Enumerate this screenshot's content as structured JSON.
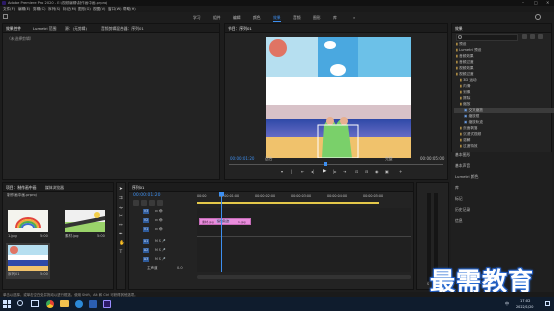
{
  "title_bar": {
    "app_title": "Adobe Premiere Pro 2020 - E:\\视频编辑\\制作画中画.prproj",
    "menu": [
      "文件(F)",
      "编辑(E)",
      "剪辑(C)",
      "序列(S)",
      "标记(M)",
      "图形(G)",
      "视图(V)",
      "窗口(W)",
      "帮助(H)"
    ]
  },
  "workspaces": [
    "学习",
    "组件",
    "编辑",
    "颜色",
    "效果",
    "音频",
    "图形",
    "库",
    "»"
  ],
  "effect_controls": {
    "tabs": [
      "效果控件",
      "Lumetri 范围",
      "源：(无剪辑)",
      "音频剪辑混合器：序列01"
    ],
    "placeholder": "（未选择剪辑）"
  },
  "program_monitor": {
    "tab": "节目：序列01",
    "timecode_left": "00:00:01:20",
    "fit": "适合",
    "quality": "完整",
    "timecode_right": "00:00:05:00"
  },
  "effects_panel": {
    "title": "效果",
    "items": [
      "预设",
      "Lumetri 预设",
      "音频效果",
      "音频过渡",
      "视频效果",
      "视频过渡",
      "3D 运动",
      "内滑",
      "划像",
      "擦除",
      "缩放",
      "交叉缩放",
      "缩放框",
      "缩放轨迹",
      "页面剥落",
      "沉浸式视频",
      "溶解",
      "过渡特效"
    ],
    "sections": [
      "基本图形",
      "基本声音",
      "Lumetri 颜色",
      "库",
      "标记",
      "历史记录",
      "信息"
    ]
  },
  "project_panel": {
    "tabs": [
      "项目：制作画中画",
      "媒体浏览器"
    ],
    "project_file": "制作画中画.prproj",
    "clips": [
      {
        "name": "1.jpg",
        "duration": "5:00"
      },
      {
        "name": "素材.jpg",
        "duration": "5:00"
      },
      {
        "name": "序列01",
        "duration": "5:00"
      }
    ]
  },
  "timeline": {
    "tab": "序列01",
    "timecode": "00:00:01:20",
    "ruler": [
      "00:00",
      "00:00:01:00",
      "00:00:02:00",
      "00:00:03:00",
      "00:00:04:00",
      "00:00:05:00"
    ],
    "tracks": [
      "V3",
      "V2",
      "V1",
      "A1",
      "A2",
      "A3"
    ],
    "master": "主声道",
    "master_value": "0.0",
    "clip_labels": [
      "素材.jpg",
      "缩放轨迹",
      "1.jpg"
    ],
    "playhead_pct": 32
  },
  "status_text": "单击以选择，或单击空白处并拖动以进行框选。使用 Shift、Alt 和 Ctrl 可获得其他选项。",
  "taskbar": {
    "time": "17:02",
    "date": "2022/1/20",
    "lang": "中"
  },
  "watermark": "最需教育",
  "colors": {
    "accent": "#2a6fd6",
    "clip_pink": "#e98cdc",
    "timecode_blue": "#3d8ff0"
  }
}
